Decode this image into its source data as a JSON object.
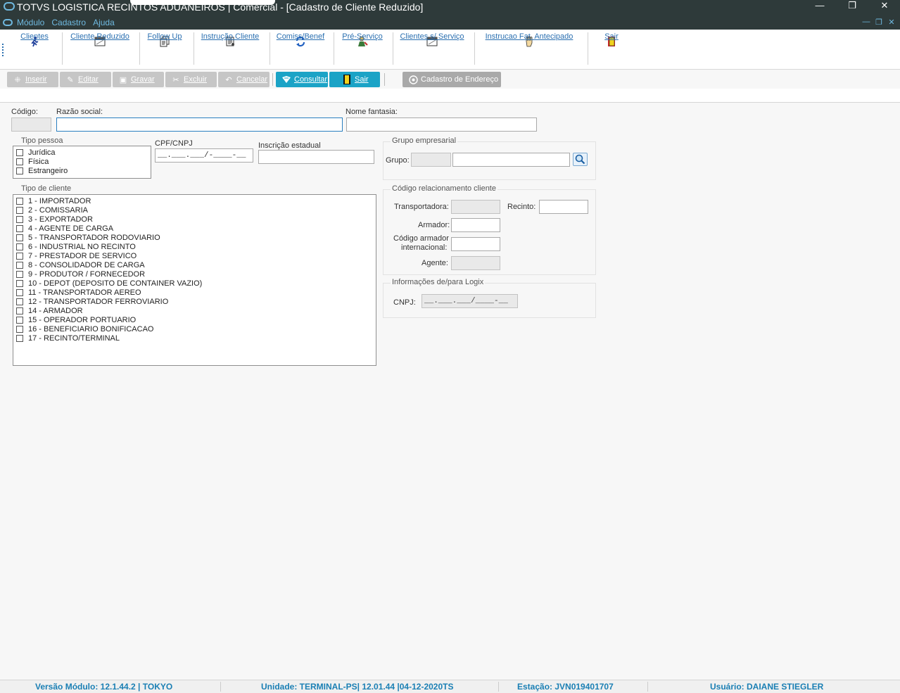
{
  "window": {
    "title": "TOTVS LOGISTICA RECINTOS ADUANEIROS | Comercial - [Cadastro de Cliente Reduzido]",
    "controls": [
      "—",
      "❐",
      "✕"
    ],
    "mdi_controls": [
      "—",
      "❐",
      "✕"
    ]
  },
  "menu": [
    "Módulo",
    "Cadastro",
    "Ajuda"
  ],
  "toolbar": [
    {
      "label": "Clientes",
      "icon": "running-person-icon"
    },
    {
      "label": "Cliente Reduzido",
      "icon": "window-icon"
    },
    {
      "label": "Follow Up",
      "icon": "documents-icon"
    },
    {
      "label": "Instrução Cliente",
      "icon": "instruction-icon"
    },
    {
      "label": "Comiss/Benef",
      "icon": "refresh-icon"
    },
    {
      "label": "Pré-Serviço",
      "icon": "person-service-icon"
    },
    {
      "label": "Clientes s/ Serviço",
      "icon": "window-icon"
    },
    {
      "label": "Instrucao Fat. Antecipado",
      "icon": "hand-icon"
    },
    {
      "label": "Sair",
      "icon": "exit-door-icon"
    }
  ],
  "actions": {
    "inserir": "Inserir",
    "editar": "Editar",
    "gravar": "Gravar",
    "excluir": "Excluir",
    "cancelar": "Cancelar",
    "consultar": "Consultar",
    "sair": "Sair",
    "cadastro_endereco": "Cadastro de Endereço"
  },
  "form": {
    "codigo_label": "Código:",
    "codigo_value": "",
    "razao_label": "Razão social:",
    "razao_value": "",
    "fantasia_label": "Nome fantasia:",
    "fantasia_value": "",
    "tipo_pessoa_title": "Tipo pessoa",
    "tipo_pessoa": [
      "Jurídica",
      "Física",
      "Estrangeiro"
    ],
    "cpf_label": "CPF/CNPJ",
    "cpf_mask": "__.___.___/-____-__",
    "ie_label": "Inscrição estadual",
    "ie_value": "",
    "grupo_empresarial_title": "Grupo empresarial",
    "grupo_label": "Grupo:",
    "tipo_cliente_title": "Tipo de cliente",
    "tipo_cliente": [
      "1 - IMPORTADOR",
      "2 - COMISSARIA",
      "3 - EXPORTADOR",
      "4 - AGENTE DE CARGA",
      "5 - TRANSPORTADOR RODOVIARIO",
      "6 - INDUSTRIAL NO RECINTO",
      "7 - PRESTADOR DE SERVICO",
      "8 - CONSOLIDADOR DE CARGA",
      "9 - PRODUTOR / FORNECEDOR",
      "10 - DEPOT (DEPOSITO DE CONTAINER VAZIO)",
      "11 - TRANSPORTADOR AEREO",
      "12 - TRANSPORTADOR FERROVIARIO",
      "14 - ARMADOR",
      "15 - OPERADOR PORTUARIO",
      "16 - BENEFICIARIO BONIFICACAO",
      "17 - RECINTO/TERMINAL"
    ],
    "rel_title": "Código relacionamento cliente",
    "transportadora_label": "Transportadora:",
    "recinto_label": "Recinto:",
    "armador_label": "Armador:",
    "cod_armador_label_1": "Código armador",
    "cod_armador_label_2": "internacional:",
    "agente_label": "Agente:",
    "logix_title": "Informações de/para Logix",
    "cnpj_label": "CNPJ:",
    "cnpj_mask": "__.___.___/____-__"
  },
  "status": {
    "versao": "Versão Módulo:  12.1.44.2  |  TOKYO",
    "unidade": "Unidade: TERMINAL-PS| 12.01.44 |04-12-2020TS",
    "estacao": "Estação: JVN019401707",
    "usuario": "Usuário: DAIANE STIEGLER"
  }
}
